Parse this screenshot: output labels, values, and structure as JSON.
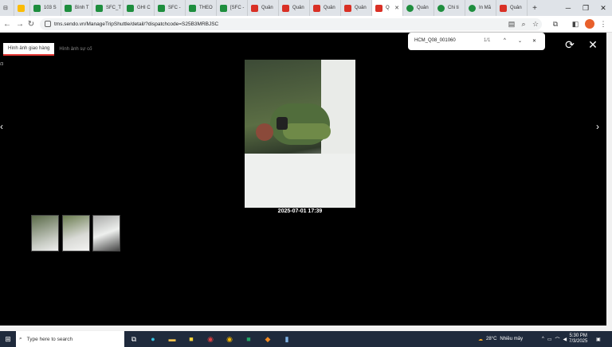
{
  "tabs": [
    {
      "label": "",
      "icon": "drive-icon"
    },
    {
      "label": "103 S",
      "icon": "sheets-icon"
    },
    {
      "label": "Bình T",
      "icon": "sheets-icon"
    },
    {
      "label": "SFC_T",
      "icon": "sheets-icon"
    },
    {
      "label": "GHI C",
      "icon": "sheets-icon"
    },
    {
      "label": "SFC -",
      "icon": "sheets-icon"
    },
    {
      "label": "THEO",
      "icon": "sheets-icon"
    },
    {
      "label": "[SFC -",
      "icon": "sheets-icon"
    },
    {
      "label": "Quản",
      "icon": "sendo-icon"
    },
    {
      "label": "Quản",
      "icon": "sendo-icon"
    },
    {
      "label": "Quản",
      "icon": "sendo-icon"
    },
    {
      "label": "Quản",
      "icon": "sendo-icon"
    },
    {
      "label": "Q",
      "icon": "sendo-icon"
    },
    {
      "label": "Quản",
      "icon": "s-icon"
    },
    {
      "label": "Chi ti",
      "icon": "s-icon"
    },
    {
      "label": "In Mã",
      "icon": "s-icon"
    },
    {
      "label": "Quản",
      "icon": "sendo-icon"
    }
  ],
  "address": {
    "url": "tms.sendo.vn/ManageTripShuttle/detail/?dispatchcode=S25B3MRBJSC"
  },
  "find": {
    "query": "HCM_Q08_001060",
    "count": "1/1"
  },
  "viewer": {
    "tab_delivery": "Hình ảnh giao hàng",
    "tab_incident": "Hình ảnh sự cố",
    "counter": "/3",
    "caption": "2025-07-01 17:39"
  },
  "taskbar": {
    "search_placeholder": "Type here to search",
    "temperature": "28°C",
    "weather": "Nhiều mây",
    "time": "5:30 PM",
    "date": "7/3/2025"
  }
}
